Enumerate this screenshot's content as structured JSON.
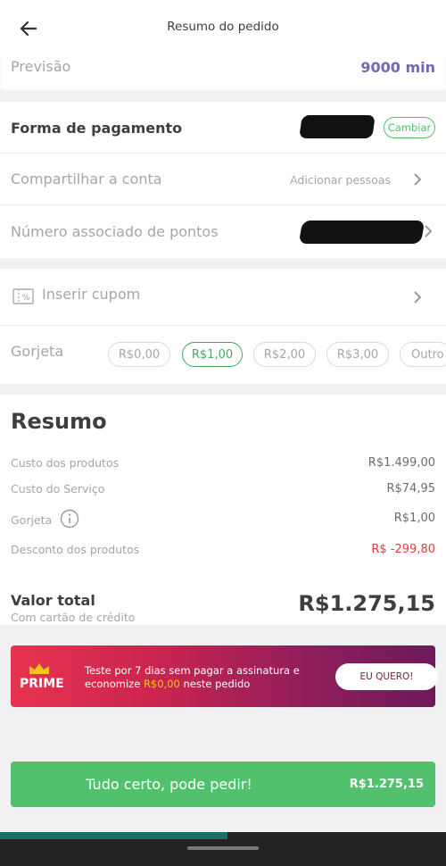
{
  "header": {
    "title": "Resumo do pedido",
    "back_icon": "arrow-left-icon"
  },
  "forecast": {
    "label": "Previsão",
    "value": "9000 min"
  },
  "payment": {
    "label": "Forma de pagamento",
    "change_label": "Cambiar"
  },
  "share": {
    "label": "Compartilhar a conta",
    "action": "Adicionar pessoas"
  },
  "points": {
    "label": "Número associado de pontos"
  },
  "coupon": {
    "label": "Inserir cupom",
    "icon": "coupon-icon"
  },
  "tip": {
    "label": "Gorjeta",
    "options": [
      "R$0,00",
      "R$1,00",
      "R$2,00",
      "R$3,00",
      "Outro"
    ],
    "selected": "R$1,00"
  },
  "summary": {
    "title": "Resumo",
    "rows": [
      {
        "label": "Custo dos produtos",
        "value": "R$1.499,00"
      },
      {
        "label": "Custo do Serviço",
        "value": "R$74,95"
      },
      {
        "label": "Gorjeta",
        "value": "R$1,00"
      },
      {
        "label": "Desconto dos produtos",
        "value": "R$ -299,80"
      }
    ],
    "total_label": "Valor total",
    "total_sub": "Com cartão de crédito",
    "total_value": "R$1.275,15"
  },
  "promo": {
    "brand": "PRIME",
    "text_line1": "Teste por 7 dias sem pagar a assinatura e",
    "text_line2_a": "economize",
    "text_line2_highlight": "R$0,00",
    "text_line2_b": "neste pedido",
    "button": "EU QUERO!"
  },
  "cta": {
    "label": "Tudo certo, pode pedir!",
    "price": "R$1.275,15"
  },
  "colors": {
    "accent_green": "#52c16d",
    "discount_red": "#e23b3b",
    "forecast_purple": "#6f69b8"
  }
}
